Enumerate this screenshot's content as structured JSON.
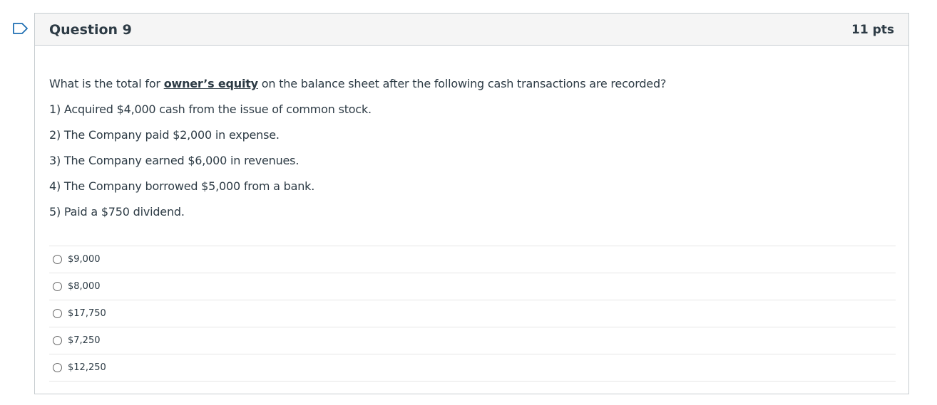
{
  "question": {
    "title": "Question 9",
    "points": "11 pts",
    "prompt": {
      "before": "What is the total for ",
      "emphasis": "owner’s equity",
      "after": " on the balance sheet after the following cash transactions are recorded?"
    },
    "transactions": [
      "1) Acquired $4,000 cash from the issue of common stock.",
      "2) The Company paid $2,000 in expense.",
      "3) The Company earned $6,000 in revenues.",
      "4) The Company borrowed $5,000 from a bank.",
      "5) Paid a $750 dividend."
    ],
    "answers": [
      "$9,000",
      "$8,000",
      "$17,750",
      "$7,250",
      "$12,250"
    ]
  },
  "icons": {
    "flag": "flag-outline-icon",
    "flag_color": "#1f6fb2"
  }
}
